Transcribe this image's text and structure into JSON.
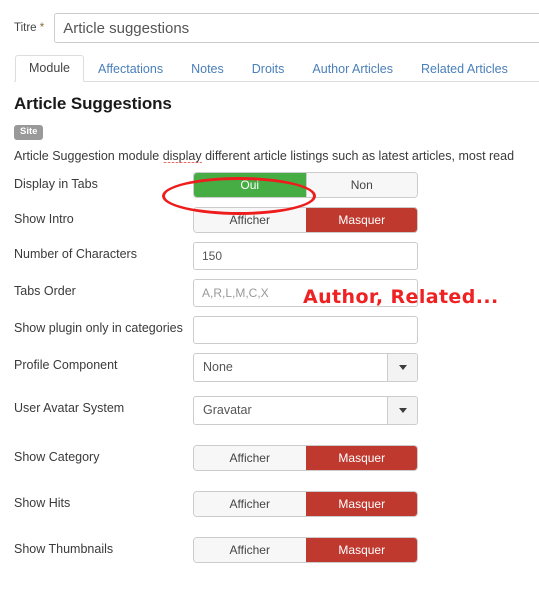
{
  "title_field": {
    "label": "Titre",
    "required_marker": "*",
    "value": "Article suggestions"
  },
  "tabs": [
    {
      "label": "Module",
      "active": true
    },
    {
      "label": "Affectations",
      "active": false
    },
    {
      "label": "Notes",
      "active": false
    },
    {
      "label": "Droits",
      "active": false
    },
    {
      "label": "Author Articles",
      "active": false
    },
    {
      "label": "Related Articles",
      "active": false
    }
  ],
  "module": {
    "heading": "Article Suggestions",
    "badge": "Site",
    "description_pre": "Article Suggestion module ",
    "description_misspelled": "display",
    "description_post": " different article listings such as latest articles, most read"
  },
  "fields": {
    "display_in_tabs": {
      "label": "Display in Tabs",
      "type": "toggle",
      "on_label": "Oui",
      "off_label": "Non",
      "selected": "Oui",
      "on_color": "#45ad44"
    },
    "show_intro": {
      "label": "Show Intro",
      "type": "toggle",
      "on_label": "Afficher",
      "off_label": "Masquer",
      "selected": "Masquer",
      "off_color": "#c0392f"
    },
    "number_of_characters": {
      "label": "Number of Characters",
      "type": "text",
      "value": "150"
    },
    "tabs_order": {
      "label": "Tabs Order",
      "type": "text",
      "value": "",
      "placeholder": "A,R,L,M,C,X"
    },
    "show_plugin_only_in_categories": {
      "label": "Show plugin only in categories",
      "type": "text",
      "value": ""
    },
    "profile_component": {
      "label": "Profile Component",
      "type": "select",
      "value": "None"
    },
    "user_avatar_system": {
      "label": "User Avatar System",
      "type": "select",
      "value": "Gravatar"
    },
    "show_category": {
      "label": "Show Category",
      "type": "toggle",
      "on_label": "Afficher",
      "off_label": "Masquer",
      "selected": "Masquer"
    },
    "show_hits": {
      "label": "Show Hits",
      "type": "toggle",
      "on_label": "Afficher",
      "off_label": "Masquer",
      "selected": "Masquer"
    },
    "show_thumbnails": {
      "label": "Show Thumbnails",
      "type": "toggle",
      "on_label": "Afficher",
      "off_label": "Masquer",
      "selected": "Masquer"
    }
  },
  "annotations": {
    "ellipse_target": "display-in-tabs-toggle",
    "note_text": "Author, Related...",
    "ink_color": "#ee2222"
  }
}
